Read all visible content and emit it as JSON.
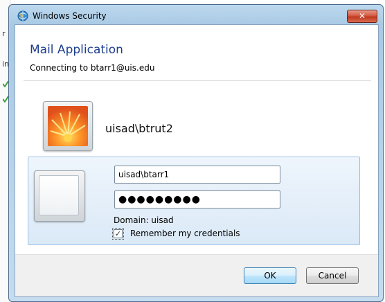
{
  "window": {
    "title": "Windows Security",
    "close_glyph": "✕",
    "icon": "shield-globe-icon"
  },
  "background_window": {
    "chars": [
      "r",
      "in"
    ]
  },
  "dialog": {
    "heading": "Mail Application",
    "subtext": "Connecting to btarr1@uis.edu"
  },
  "saved_user": {
    "name": "uisad\\btrut2",
    "tile_image": "flower-user-picture"
  },
  "credentials": {
    "username_value": "uisad\\btarr1",
    "password_mask": "●●●●●●●●●",
    "domain_label": "Domain: uisad",
    "remember_label": "Remember my credentials",
    "remember_checked": true,
    "check_glyph": "✓"
  },
  "buttons": {
    "ok": "OK",
    "cancel": "Cancel"
  },
  "colors": {
    "heading": "#1e3f8f",
    "panel_border": "#99c0e6",
    "close_red": "#c0391f"
  }
}
